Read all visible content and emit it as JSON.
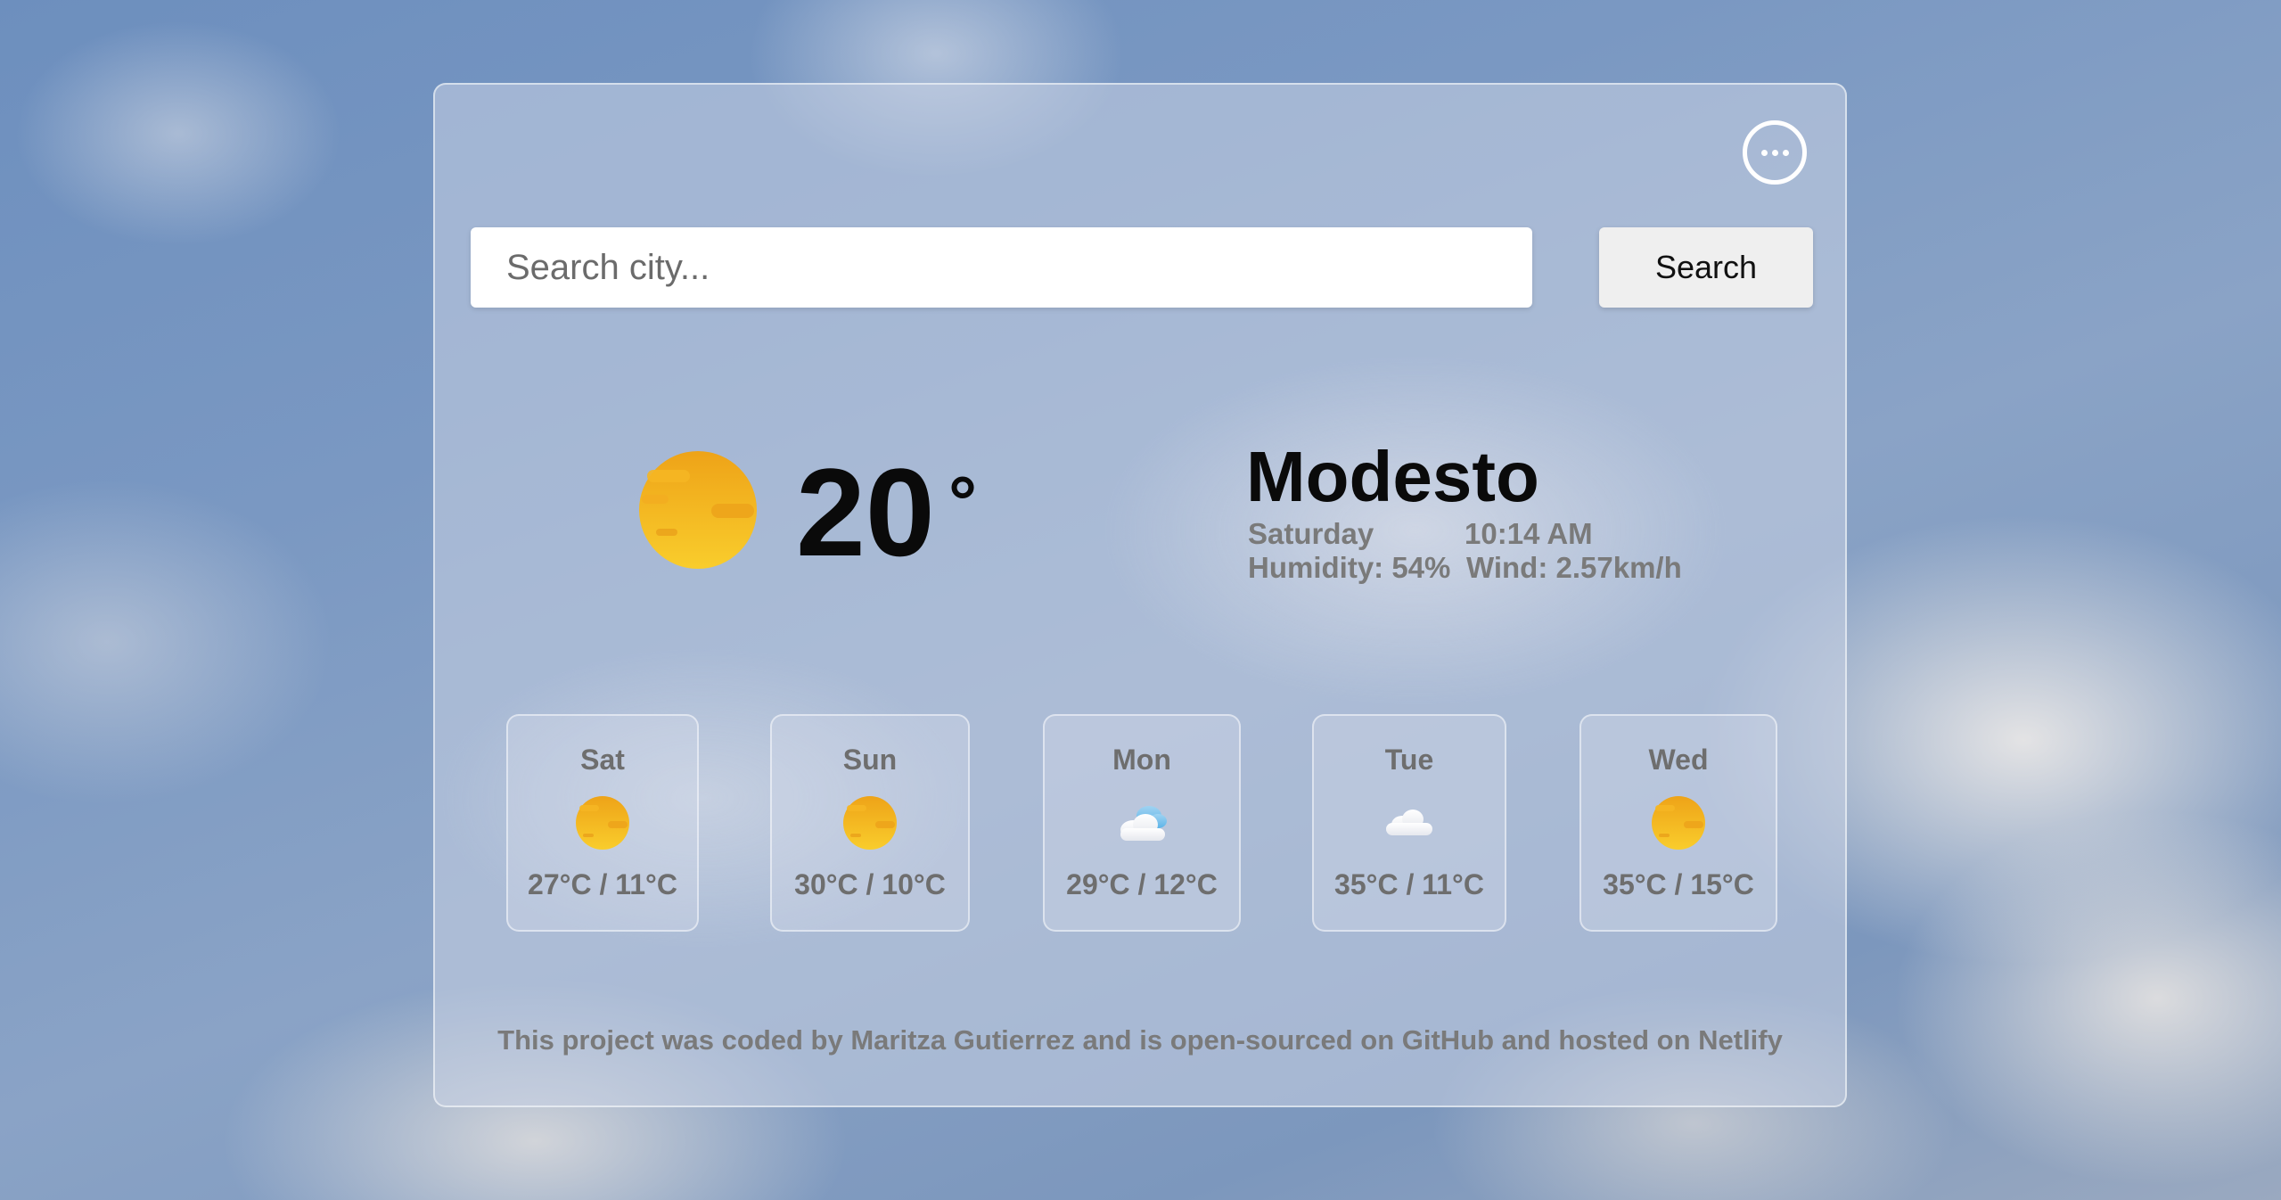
{
  "header": {
    "menu_icon": "ellipsis-icon"
  },
  "search": {
    "placeholder": "Search city...",
    "value": "",
    "button_label": "Search"
  },
  "current": {
    "icon": "sun-icon",
    "temperature": "20",
    "unit": "°",
    "city": "Modesto",
    "day": "Saturday",
    "time": "10:14 AM",
    "humidity": "Humidity: 54%",
    "wind": "Wind: 2.57km/h"
  },
  "forecast": [
    {
      "day": "Sat",
      "icon": "sun-icon",
      "temps": "27°C / 11°C"
    },
    {
      "day": "Sun",
      "icon": "sun-icon",
      "temps": "30°C / 10°C"
    },
    {
      "day": "Mon",
      "icon": "cloud-rain-icon",
      "temps": "29°C / 12°C"
    },
    {
      "day": "Tue",
      "icon": "cloud-icon",
      "temps": "35°C / 11°C"
    },
    {
      "day": "Wed",
      "icon": "sun-icon",
      "temps": "35°C / 15°C"
    }
  ],
  "footer": {
    "prefix": "This project was coded by ",
    "author": "Maritza Gutierrez",
    "middle": " and is ",
    "open_sourced": "open-sourced on GitHub",
    "connector": " and ",
    "hosted": "hosted on Netlify"
  },
  "colors": {
    "sun_top": "#f0a81a",
    "sun_bottom": "#f7c92a",
    "text_primary": "#0a0a0a",
    "text_secondary": "#7a7a7a"
  }
}
